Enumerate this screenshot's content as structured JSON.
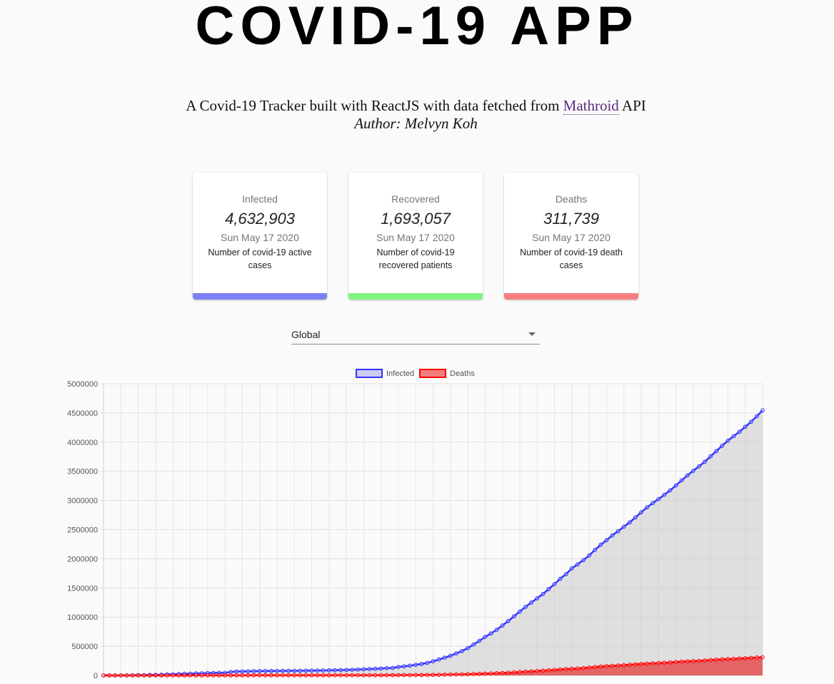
{
  "header": {
    "title": "COVID-19 APP",
    "subtitle_prefix": "A Covid-19 Tracker built with ReactJS with data fetched from ",
    "subtitle_link": "Mathroid",
    "subtitle_suffix": " API",
    "author": "Author: Melvyn Koh"
  },
  "cards": [
    {
      "label": "Infected",
      "value": "4,632,903",
      "date": "Sun May 17 2020",
      "desc": "Number of covid-19 active cases",
      "color": "#7f7ff5"
    },
    {
      "label": "Recovered",
      "value": "1,693,057",
      "date": "Sun May 17 2020",
      "desc": "Number of covid-19 recovered patients",
      "color": "#7ff57f"
    },
    {
      "label": "Deaths",
      "value": "311,739",
      "date": "Sun May 17 2020",
      "desc": "Number of covid-19 death cases",
      "color": "#f57f7f"
    }
  ],
  "country_select": {
    "value": "Global"
  },
  "chart_data": {
    "type": "area",
    "legend": {
      "position": "top"
    },
    "ylim": [
      0,
      5000000
    ],
    "yticks": [
      0,
      500000,
      1000000,
      1500000,
      2000000,
      2500000,
      3000000,
      3500000,
      4000000,
      4500000,
      5000000
    ],
    "grid": true,
    "series": [
      {
        "name": "Infected",
        "color": "#3333ff",
        "values": [
          555,
          654,
          941,
          1434,
          2118,
          2927,
          5578,
          6166,
          8234,
          9927,
          12038,
          16787,
          19881,
          23892,
          27635,
          30817,
          34391,
          37120,
          40150,
          42762,
          44802,
          45221,
          60368,
          66885,
          69030,
          71224,
          73258,
          75136,
          75639,
          76197,
          76819,
          78572,
          78958,
          79561,
          80406,
          81388,
          82746,
          84112,
          86011,
          88369,
          90306,
          92840,
          95120,
          97886,
          101801,
          105847,
          109821,
          113590,
          118620,
          125875,
          128352,
          145205,
          156101,
          167454,
          181574,
          197102,
          214821,
          242570,
          272208,
          304507,
          336953,
          378235,
          418045,
          467653,
          529591,
          593291,
          660693,
          720140,
          782389,
          857487,
          932605,
          1013466,
          1095917,
          1176060,
          1249754,
          1321481,
          1396476,
          1480202,
          1565278,
          1657526,
          1735650,
          1834721,
          1904838,
          1976191,
          2056055,
          2152437,
          2240190,
          2317759,
          2401378,
          2472259,
          2549123,
          2624074,
          2708885,
          2795735,
          2881140,
          2955033,
          3023722,
          3097229,
          3172287,
          3256846,
          3343777,
          3427343,
          3506729,
          3583055,
          3662691,
          3755341,
          3845718,
          3938064,
          4024009,
          4101699,
          4177502,
          4261747,
          4347018,
          4442163,
          4542347
        ]
      },
      {
        "name": "Deaths",
        "color": "#ff0000",
        "values": [
          17,
          18,
          26,
          42,
          56,
          82,
          131,
          133,
          171,
          213,
          259,
          362,
          426,
          492,
          564,
          634,
          719,
          806,
          906,
          1013,
          1113,
          1118,
          1371,
          1523,
          1666,
          1770,
          1868,
          2007,
          2122,
          2247,
          2251,
          2458,
          2469,
          2629,
          2708,
          2770,
          2814,
          2872,
          2941,
          2996,
          3085,
          3160,
          3254,
          3348,
          3460,
          3558,
          3802,
          3988,
          4262,
          4615,
          4720,
          5404,
          5819,
          6440,
          7126,
          7905,
          8733,
          9867,
          11299,
          12973,
          14651,
          16505,
          18625,
          21181,
          23970,
          27198,
          30652,
          33925,
          37582,
          42107,
          46809,
          52983,
          58787,
          64606,
          69374,
          74565,
          81865,
          88338,
          95455,
          102525,
          108503,
          114090,
          119482,
          125984,
          134177,
          143800,
          153822,
          159510,
          165044,
          169986,
          176583,
          183066,
          190858,
          197159,
          202846,
          206567,
          211167,
          217896,
          224172,
          230982,
          236937,
          242153,
          245991,
          251051,
          257331,
          263958,
          270447,
          275820,
          280048,
          283808,
          289215,
          295096,
          300917,
          307097,
          311739
        ]
      }
    ]
  }
}
